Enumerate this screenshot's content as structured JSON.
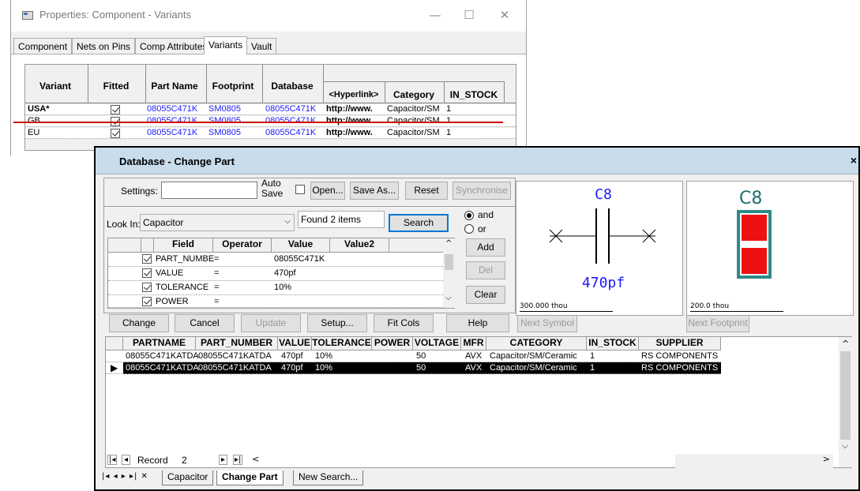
{
  "props_window": {
    "title": "Properties: Component - Variants",
    "controls": {
      "minimize": "—",
      "maximize": "☐",
      "close": "✕"
    },
    "tabs": [
      "Component",
      "Nets on Pins",
      "Comp Attributes",
      "Variants",
      "Vault"
    ],
    "active_tab": "Variants",
    "variants_grid": {
      "headers": {
        "variant": "Variant",
        "fitted": "Fitted",
        "part_name": "Part Name",
        "footprint": "Footprint",
        "database": "Database",
        "hyperlink": "<Hyperlink>",
        "category": "Category",
        "in_stock": "IN_STOCK"
      },
      "rows": [
        {
          "variant": "USA*",
          "fitted": true,
          "part_name": "08055C471K",
          "footprint": "SM0805",
          "database": "08055C471K",
          "hyperlink": "http://www.",
          "category": "Capacitor/SM",
          "in_stock": "1"
        },
        {
          "variant": "GB",
          "fitted": true,
          "part_name": "08055C471K",
          "footprint": "SM0805",
          "database": "08055C471K",
          "hyperlink": "http://www.",
          "category": "Capacitor/SM",
          "in_stock": "1"
        },
        {
          "variant": "EU",
          "fitted": true,
          "part_name": "08055C471K",
          "footprint": "SM0805",
          "database": "08055C471K",
          "hyperlink": "http://www.",
          "category": "Capacitor/SM",
          "in_stock": "1"
        }
      ]
    }
  },
  "db_dialog": {
    "title": "Database - Change Part",
    "close": "×",
    "settings_label": "Settings:",
    "settings_value": "",
    "auto_save_label_1": "Auto",
    "auto_save_label_2": "Save",
    "auto_save_checked": false,
    "buttons": {
      "open": "Open...",
      "save_as": "Save As...",
      "reset": "Reset",
      "synchronise": "Synchronise",
      "search": "Search",
      "add": "Add",
      "del": "Del",
      "clear": "Clear",
      "change": "Change",
      "cancel": "Cancel",
      "update": "Update",
      "setup": "Setup...",
      "fit_cols": "Fit Cols",
      "help": "Help",
      "next_symbol": "Next Symbol",
      "next_footprint": "Next Footprint"
    },
    "look_in_label": "Look In:",
    "look_in_value": "Capacitor",
    "found_text": "Found 2 items",
    "logic": {
      "and": "and",
      "or": "or",
      "selected": "and"
    },
    "criteria": {
      "headers": {
        "field": "Field",
        "operator": "Operator",
        "value": "Value",
        "value2": "Value2"
      },
      "rows": [
        {
          "checked": true,
          "field": "PART_NUMBE",
          "operator": "=",
          "value": "08055C471K",
          "value2": ""
        },
        {
          "checked": true,
          "field": "VALUE",
          "operator": "=",
          "value": "470pf",
          "value2": ""
        },
        {
          "checked": true,
          "field": "TOLERANCE",
          "operator": "=",
          "value": "10%",
          "value2": ""
        },
        {
          "checked": true,
          "field": "POWER",
          "operator": "=",
          "value": "",
          "value2": ""
        }
      ]
    },
    "symbol_preview": {
      "designator": "C8",
      "value": "470pf",
      "scale": "300.000 thou",
      "color": "#1a1aff"
    },
    "footprint_preview": {
      "designator": "C8",
      "scale": "200.0 thou",
      "pad_color": "#ee1111",
      "body_color": "#2e8b87",
      "text_color": "#1e6e6e"
    },
    "results": {
      "headers": [
        "PARTNAME",
        "PART_NUMBER",
        "VALUE",
        "TOLERANCE",
        "POWER",
        "VOLTAGE",
        "MFR",
        "CATEGORY",
        "IN_STOCK",
        "SUPPLIER"
      ],
      "rows": [
        {
          "partname": "08055C471KATDA",
          "part_number": "08055C471KATDA",
          "value": "470pf",
          "tolerance": "10%",
          "power": "",
          "voltage": "50",
          "mfr": "AVX",
          "category": "Capacitor/SM/Ceramic",
          "in_stock": "1",
          "supplier": "RS COMPONENTS"
        },
        {
          "partname": "08055C471KATDA",
          "part_number": "08055C471KATDA",
          "value": "470pf",
          "tolerance": "10%",
          "power": "",
          "voltage": "50",
          "mfr": "AVX",
          "category": "Capacitor/SM/Ceramic",
          "in_stock": "1",
          "supplier": "RS COMPONENTS"
        }
      ],
      "selected_row": 1
    },
    "record_label": "Record",
    "record_number": "2",
    "sheet_tabs": [
      "Capacitor",
      "Change Part",
      "New Search..."
    ],
    "active_sheet": "Change Part"
  }
}
